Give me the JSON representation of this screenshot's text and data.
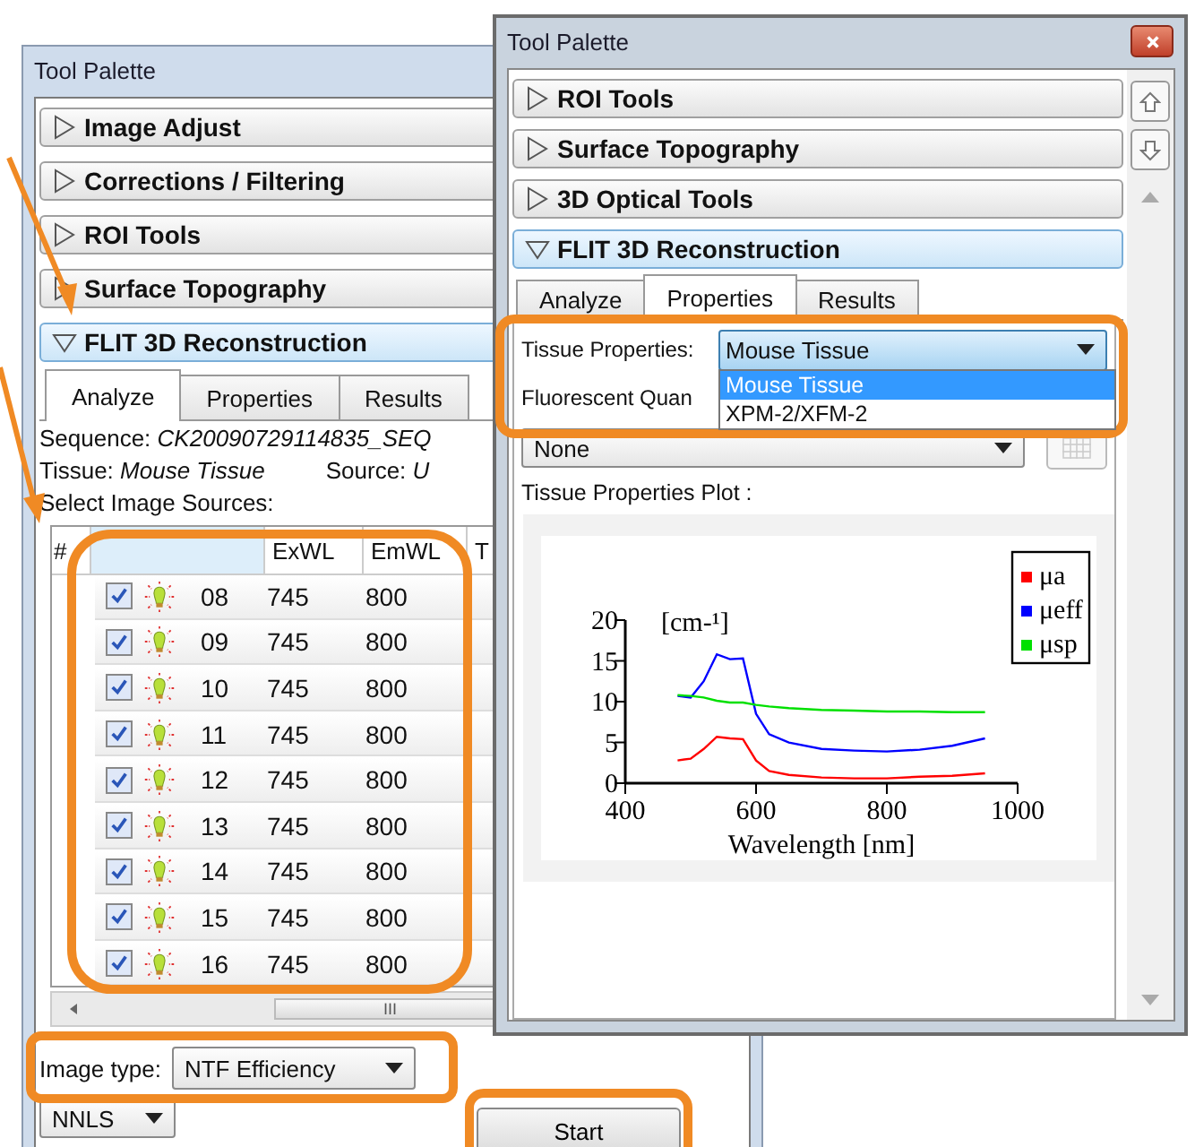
{
  "left_palette": {
    "title": "Tool Palette",
    "sections": [
      {
        "label": "Image Adjust",
        "expanded": false
      },
      {
        "label": "Corrections / Filtering",
        "expanded": false
      },
      {
        "label": "ROI Tools",
        "expanded": false
      },
      {
        "label": "Surface Topography",
        "expanded": false
      },
      {
        "label": "FLIT 3D Reconstruction",
        "expanded": true
      }
    ],
    "tabs": [
      {
        "label": "Analyze",
        "selected": true
      },
      {
        "label": "Properties",
        "selected": false
      },
      {
        "label": "Results",
        "selected": false
      }
    ],
    "sequence": {
      "label": "Sequence:",
      "value": "CK20090729114835_SEQ"
    },
    "tissue": {
      "label": "Tissue:",
      "value": "Mouse Tissue"
    },
    "source": {
      "label": "Source:",
      "value": "U"
    },
    "sources_label": "Select Image Sources:",
    "columns": [
      "#",
      "ExWL",
      "EmWL",
      "T"
    ],
    "rows": [
      {
        "checked": true,
        "number": "08",
        "exwl": "745",
        "emwl": "800"
      },
      {
        "checked": true,
        "number": "09",
        "exwl": "745",
        "emwl": "800"
      },
      {
        "checked": true,
        "number": "10",
        "exwl": "745",
        "emwl": "800"
      },
      {
        "checked": true,
        "number": "11",
        "exwl": "745",
        "emwl": "800"
      },
      {
        "checked": true,
        "number": "12",
        "exwl": "745",
        "emwl": "800"
      },
      {
        "checked": true,
        "number": "13",
        "exwl": "745",
        "emwl": "800"
      },
      {
        "checked": true,
        "number": "14",
        "exwl": "745",
        "emwl": "800"
      },
      {
        "checked": true,
        "number": "15",
        "exwl": "745",
        "emwl": "800"
      },
      {
        "checked": true,
        "number": "16",
        "exwl": "745",
        "emwl": "800"
      }
    ],
    "scrollbar_grip": "III",
    "image_type": {
      "label": "Image type:",
      "value": "NTF Efficiency"
    },
    "method": {
      "value": "NNLS"
    },
    "start_button": "Start"
  },
  "right_palette": {
    "title": "Tool Palette",
    "sections": [
      {
        "label": "ROI Tools",
        "expanded": false
      },
      {
        "label": "Surface Topography",
        "expanded": false
      },
      {
        "label": "3D Optical Tools",
        "expanded": false
      },
      {
        "label": "FLIT 3D Reconstruction",
        "expanded": true
      }
    ],
    "tabs": [
      {
        "label": "Analyze",
        "selected": false
      },
      {
        "label": "Properties",
        "selected": true
      },
      {
        "label": "Results",
        "selected": false
      }
    ],
    "tissue_properties": {
      "label": "Tissue Properties:",
      "value": "Mouse Tissue",
      "options": [
        {
          "label": "Mouse Tissue",
          "selected": true
        },
        {
          "label": "XPM-2/XFM-2",
          "selected": false
        }
      ]
    },
    "fluorescent_label": "Fluorescent Quan",
    "quant_select": {
      "value": "None"
    },
    "plot_label": "Tissue Properties Plot :",
    "chart_data": {
      "type": "line",
      "xlabel": "Wavelength [nm]",
      "ylabel": "[cm-¹]",
      "x": [
        480,
        500,
        520,
        540,
        560,
        580,
        600,
        620,
        650,
        700,
        750,
        800,
        850,
        900,
        950
      ],
      "series": [
        {
          "name": "μa",
          "color": "#ff0000",
          "values": [
            2.8,
            3,
            4.2,
            5.7,
            5.5,
            5.4,
            2.8,
            1.5,
            1.0,
            0.7,
            0.6,
            0.6,
            0.8,
            0.9,
            1.2
          ]
        },
        {
          "name": "μeff",
          "color": "#0000ff",
          "values": [
            10.7,
            10.5,
            12.5,
            15.8,
            15.2,
            15.3,
            8.5,
            6,
            5,
            4.2,
            4.0,
            3.9,
            4.1,
            4.6,
            5.5
          ]
        },
        {
          "name": "μsp",
          "color": "#00e000",
          "values": [
            10.8,
            10.7,
            10.5,
            10.1,
            9.9,
            9.9,
            9.6,
            9.4,
            9.2,
            9.0,
            8.9,
            8.8,
            8.8,
            8.7,
            8.7
          ]
        }
      ],
      "legend": true,
      "xlim": [
        400,
        1000
      ],
      "ylim": [
        0,
        20
      ],
      "xticks": [
        400,
        600,
        800,
        1000
      ],
      "yticks": [
        0,
        5,
        10,
        15,
        20
      ]
    }
  }
}
